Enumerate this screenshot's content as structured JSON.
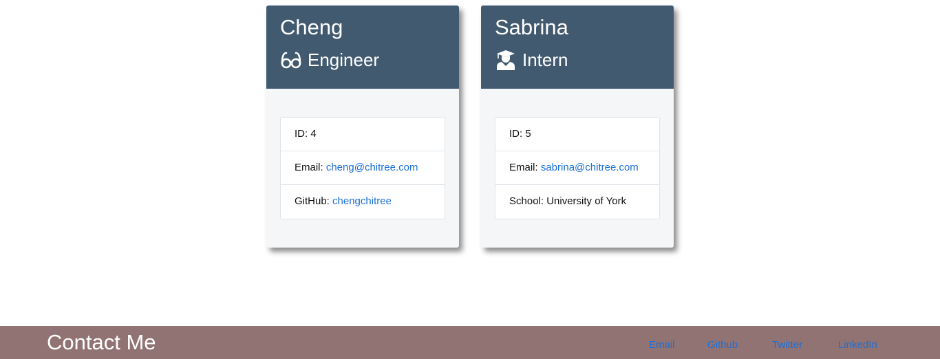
{
  "cards": [
    {
      "name": "Cheng",
      "role": "Engineer",
      "role_icon": "glasses-icon",
      "id_label": "ID: ",
      "id_value": "4",
      "email_label": "Email: ",
      "email_value": "cheng@chitree.com",
      "extra_label": "GitHub: ",
      "extra_value": "chengchitree"
    },
    {
      "name": "Sabrina",
      "role": "Intern",
      "role_icon": "graduate-icon",
      "id_label": "ID: ",
      "id_value": "5",
      "email_label": "Email: ",
      "email_value": "sabrina@chitree.com",
      "extra_label": "School: ",
      "extra_value": "University of York"
    }
  ],
  "footer": {
    "title": "Contact Me",
    "links": [
      "Email",
      "Github",
      "Twitter",
      "LinkedIn"
    ]
  },
  "colors": {
    "card_header": "#425a70",
    "card_body": "#f4f6f8",
    "footer_bg": "#917373",
    "link": "#1a6fd8"
  }
}
